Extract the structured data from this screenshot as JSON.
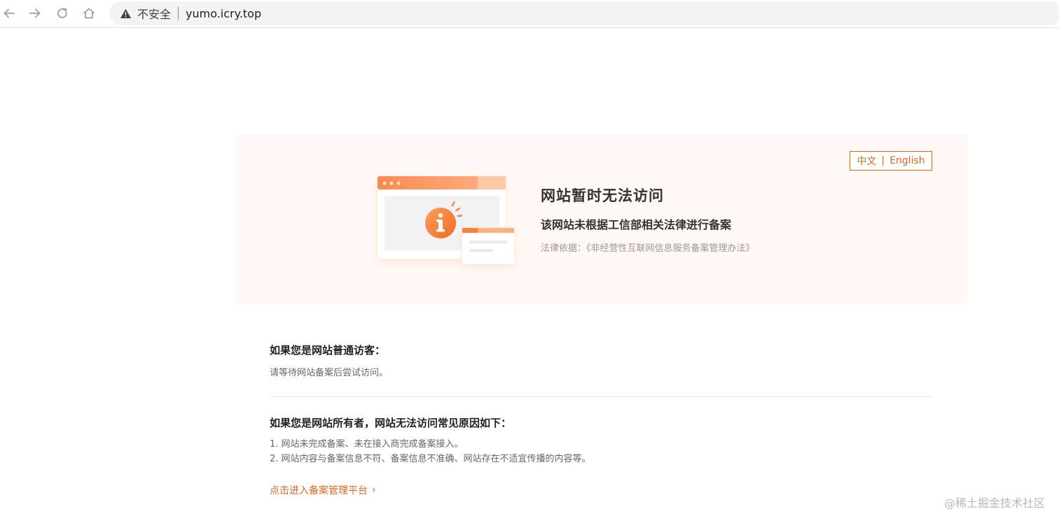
{
  "browser": {
    "security_label": "不安全",
    "url": "yumo.icry.top"
  },
  "banner": {
    "lang_zh": "中文",
    "lang_sep": "|",
    "lang_en": "English",
    "title": "网站暂时无法访问",
    "subtitle": "该网站未根据工信部相关法律进行备案",
    "law": "法律依据：《非经营性互联网信息服务备案管理办法》"
  },
  "visitor": {
    "title": "如果您是网站普通访客：",
    "text": "请等待网站备案后尝试访问。"
  },
  "owner": {
    "title": "如果您是网站所有者，网站无法访问常见原因如下：",
    "reasons": [
      "1. 网站未完成备案、未在接入商完成备案接入。",
      "2. 网站内容与备案信息不符、备案信息不准确、网站存在不适宜传播的内容等。"
    ],
    "link": "点击进入备案管理平台",
    "link_chevron": "›"
  },
  "watermark": "@稀土掘金技术社区",
  "colors": {
    "accent": "#e0661f",
    "banner_bg": "#fff8f4"
  }
}
